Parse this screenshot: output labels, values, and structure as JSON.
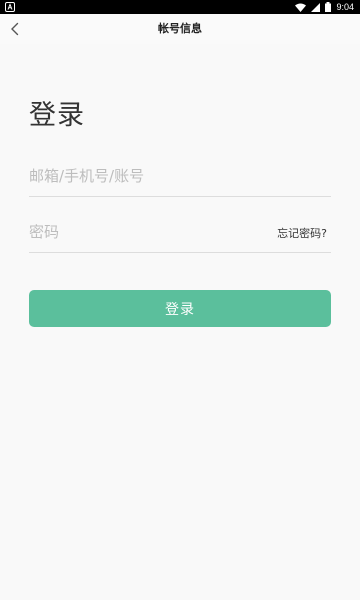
{
  "status_bar": {
    "time": "9:04",
    "left_icon": "a-notification-icon",
    "icons": [
      "wifi-icon",
      "signal-icon",
      "battery-icon"
    ]
  },
  "app_bar": {
    "title": "帐号信息",
    "back_icon": "chevron-left-icon"
  },
  "login": {
    "heading": "登录",
    "account_placeholder": "邮箱/手机号/账号",
    "account_value": "",
    "password_placeholder": "密码",
    "password_value": "",
    "forgot_label": "忘记密码?",
    "submit_label": "登录"
  },
  "colors": {
    "primary": "#5bbf9c",
    "background": "#f9f9f9",
    "divider": "#dddddd",
    "placeholder": "#bdbdbd"
  }
}
